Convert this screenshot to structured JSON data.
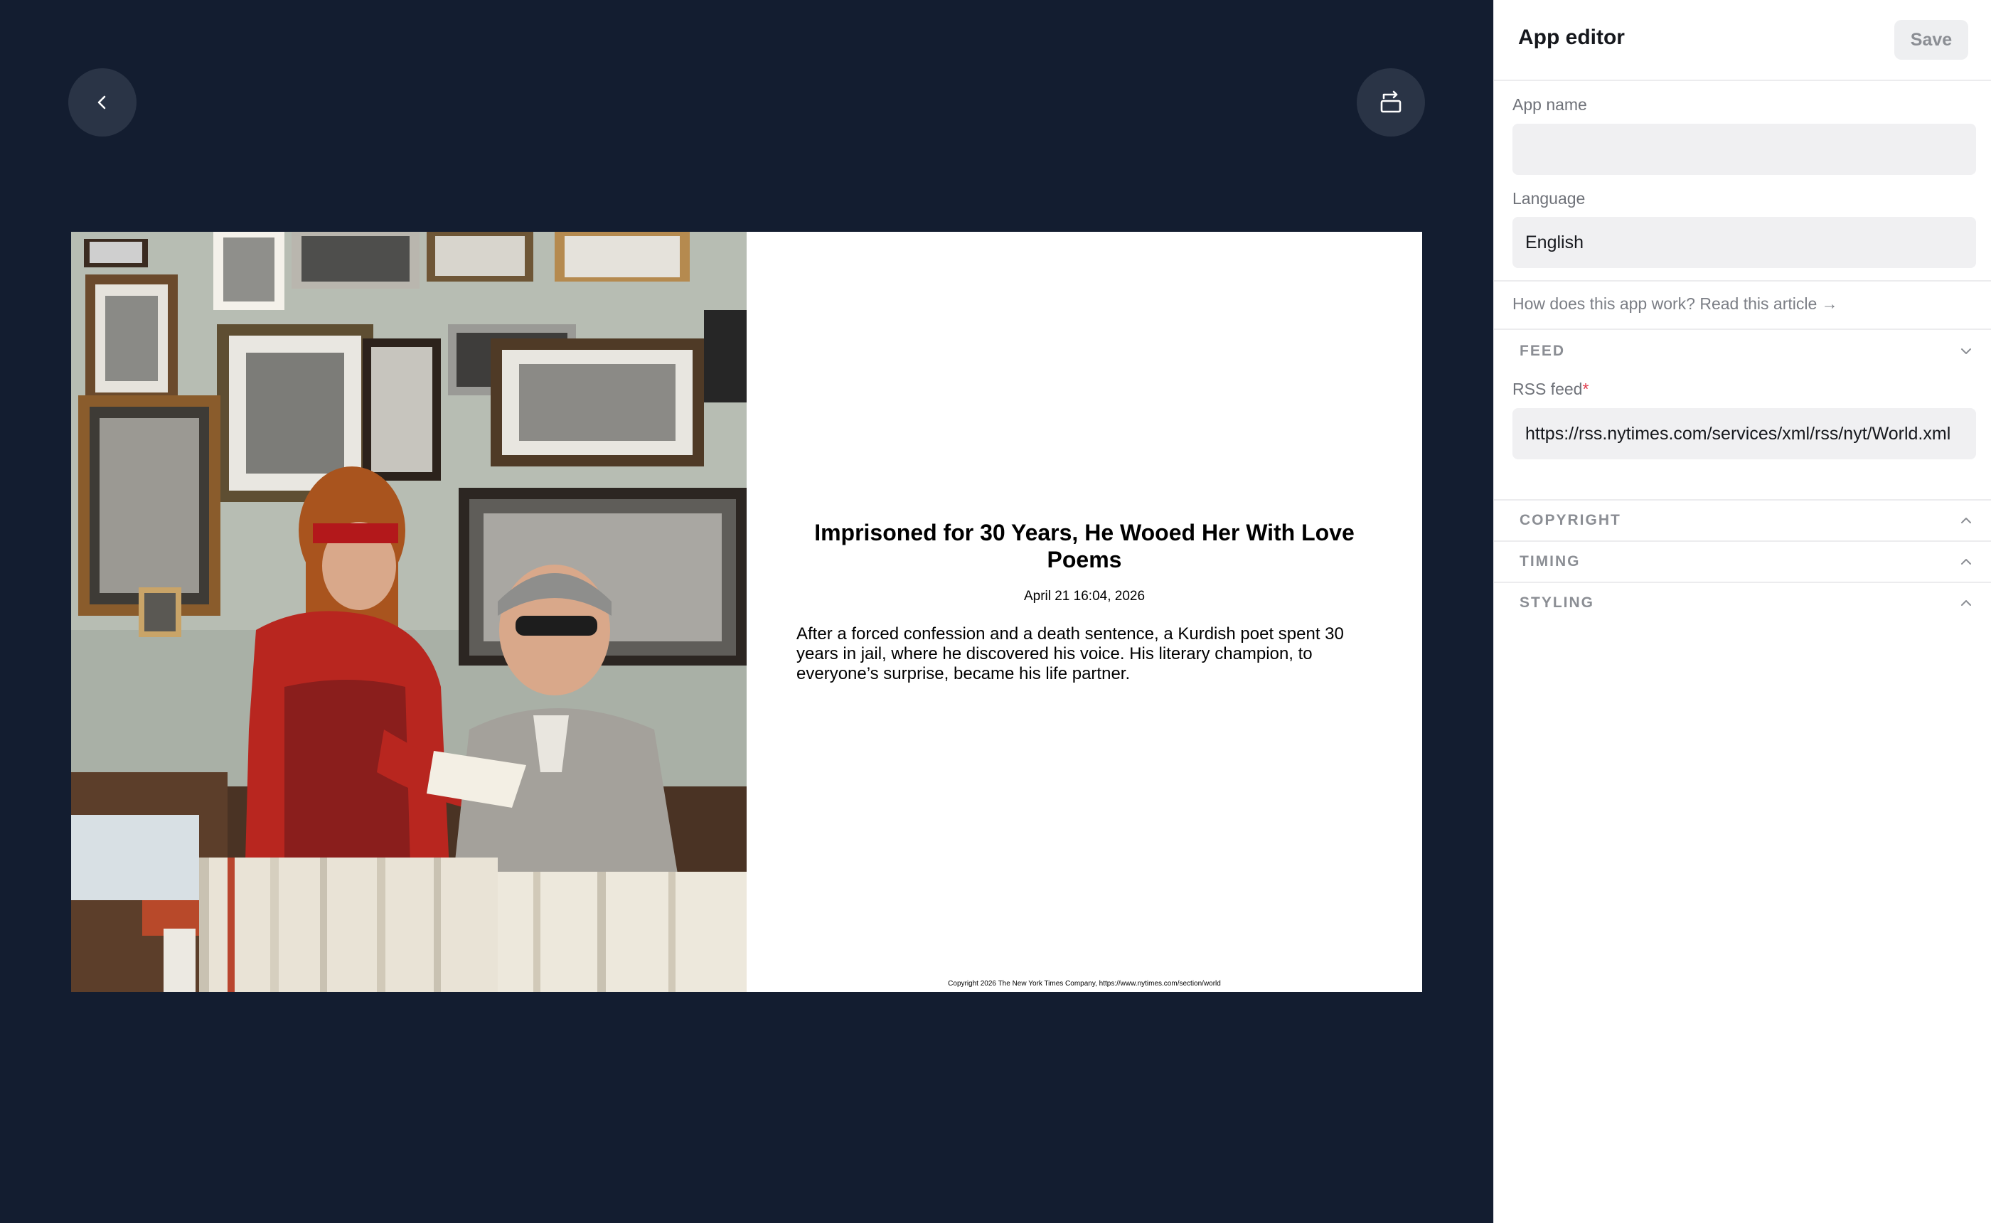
{
  "stage": {
    "back_icon": "chevron-left-icon",
    "rotate_icon": "rotate-screen-icon"
  },
  "slide": {
    "photo_icon": "article-photo",
    "headline": "Imprisoned for 30 Years, He Wooed Her With Love Poems",
    "date": "April 21 16:04, 2026",
    "summary": "After a forced confession and a death sentence, a Kurdish poet spent 30 years in jail, where he discovered his voice. His literary champion, to everyone’s surprise, became his life partner.",
    "copyright": "Copyright 2026 The New York Times Company, https://www.nytimes.com/section/world"
  },
  "panel": {
    "title": "App editor",
    "save_label": "Save",
    "app_name_label": "App name",
    "app_name_value": "",
    "language_label": "Language",
    "language_value": "English",
    "help_link": "How does this app work? Read this article →",
    "sections": {
      "feed": {
        "label": "FEED",
        "expanded": true
      },
      "copyright": {
        "label": "COPYRIGHT",
        "expanded": false
      },
      "timing": {
        "label": "TIMING",
        "expanded": false
      },
      "styling": {
        "label": "STYLING",
        "expanded": false
      }
    },
    "rss_label": "RSS feed",
    "rss_required_mark": "*",
    "rss_value": "https://rss.nytimes.com/services/xml/rss/nyt/World.xml"
  },
  "colors": {
    "stage_bg": "#131d30",
    "button_bg": "#2a3446",
    "required": "#e0394a",
    "section_label": "#8b8e94"
  }
}
